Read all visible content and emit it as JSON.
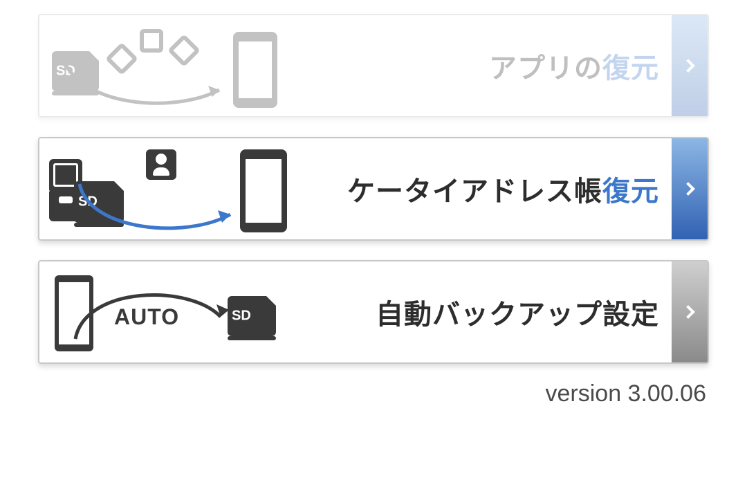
{
  "items": [
    {
      "label_prefix": "アプリの",
      "label_accent": "復元",
      "side_color": "blue",
      "disabled": true
    },
    {
      "label_prefix": "ケータイアドレス帳",
      "label_accent": "復元",
      "side_color": "blue",
      "disabled": false
    },
    {
      "label_full": "自動バックアップ設定",
      "side_color": "gray",
      "disabled": false
    }
  ],
  "auto_label": "AUTO",
  "sd_label": "SD",
  "version": "version 3.00.06"
}
